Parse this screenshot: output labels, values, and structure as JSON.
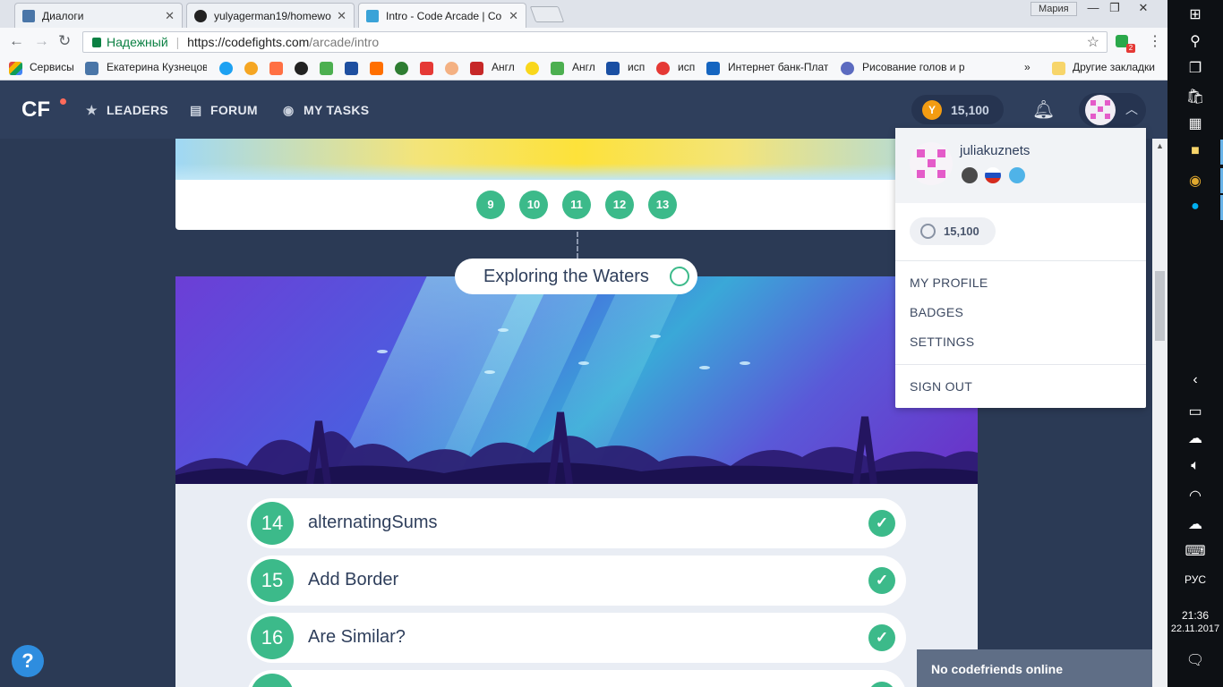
{
  "browser": {
    "tabs": [
      {
        "title": "Диалоги",
        "icon_color": "#4a76a8"
      },
      {
        "title": "yulyagerman19/homewo",
        "icon_color": "#222222"
      },
      {
        "title": "Intro - Code Arcade | Co",
        "icon_color": "#3aa3d8"
      }
    ],
    "profile_name": "Мария",
    "window_controls": {
      "minimize": "—",
      "restore": "❐",
      "close": "✕"
    },
    "secure_label": "Надежный",
    "url_host": "https://codefights.com",
    "url_path": "/arcade/intro",
    "ext_badge": "2",
    "bookmarks": [
      {
        "label": "Сервисы",
        "color": "#e04a3f"
      },
      {
        "label": "Екатерина Кузнецов",
        "color": "#4a76a8"
      },
      {
        "label": "Англ",
        "color": "#c62828"
      },
      {
        "label": "Англ",
        "color": "#4caf50"
      },
      {
        "label": "исп",
        "color": "#1a4fa3"
      },
      {
        "label": "исп",
        "color": "#e53935"
      },
      {
        "label": "Интернет банк-Плат",
        "color": "#1565c0"
      },
      {
        "label": "Рисование голов и р",
        "color": "#5c6bc0"
      }
    ],
    "other_bookmarks": "Другие закладки",
    "more": "»"
  },
  "site": {
    "logo": "CF",
    "nav": [
      {
        "label": "LEADERS",
        "icon": "star-icon"
      },
      {
        "label": "FORUM",
        "icon": "forum-icon"
      },
      {
        "label": "MY TASKS",
        "icon": "tasks-icon"
      }
    ],
    "coins": "15,100",
    "accent": "#3cba8a"
  },
  "main": {
    "levels": [
      "9",
      "10",
      "11",
      "12",
      "13"
    ],
    "topic_title": "Exploring the Waters",
    "tasks": [
      {
        "num": "14",
        "name": "alternatingSums",
        "done": true
      },
      {
        "num": "15",
        "name": "Add Border",
        "done": true
      },
      {
        "num": "16",
        "name": "Are Similar?",
        "done": true
      },
      {
        "num": "",
        "name": "",
        "done": true
      }
    ],
    "help": "?",
    "codefriends": "No codefriends online"
  },
  "dropdown": {
    "username": "juliakuznets",
    "coins": "15,100",
    "items": [
      "MY PROFILE",
      "BADGES",
      "SETTINGS"
    ],
    "signout": "SIGN OUT"
  },
  "taskbar": {
    "lang": "РУС",
    "time": "21:36",
    "date": "22.11.2017"
  }
}
